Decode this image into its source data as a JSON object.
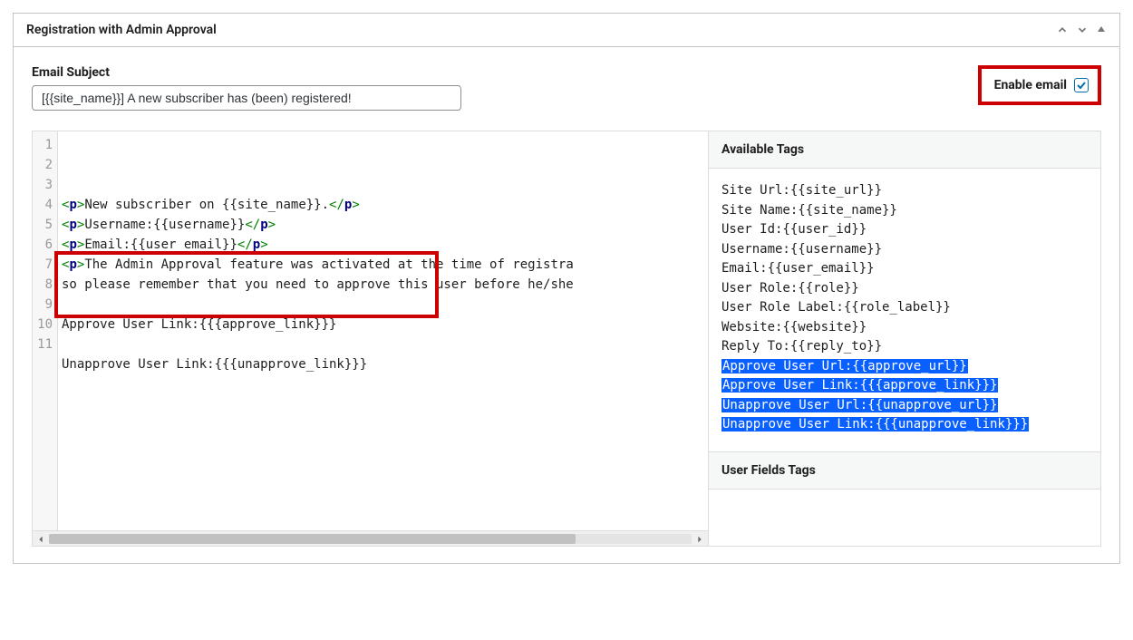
{
  "panel": {
    "title": "Registration with Admin Approval"
  },
  "subject": {
    "label": "Email Subject",
    "value": "[{{site_name}}] A new subscriber has (been) registered!"
  },
  "enable": {
    "label": "Enable email",
    "checked": true
  },
  "code": {
    "lines": [
      [
        {
          "t": "<p>",
          "c": "tag"
        },
        {
          "t": "New subscriber on {{site_name}}.",
          "c": ""
        },
        {
          "t": "</p>",
          "c": "tag"
        }
      ],
      [
        {
          "t": "<p>",
          "c": "tag"
        },
        {
          "t": "Username:{{username}}",
          "c": ""
        },
        {
          "t": "</p>",
          "c": "tag"
        }
      ],
      [
        {
          "t": "<p>",
          "c": "tag"
        },
        {
          "t": "Email:{{user_email}}",
          "c": ""
        },
        {
          "t": "</p>",
          "c": "tag"
        }
      ],
      [
        {
          "t": "<p>",
          "c": "tag"
        },
        {
          "t": "The Admin Approval feature was activated at the time of registra",
          "c": ""
        }
      ],
      [
        {
          "t": "so please remember that you need to approve this user before he/she",
          "c": ""
        }
      ],
      [],
      [
        {
          "t": "Approve User Link:{{{approve_link}}}",
          "c": ""
        }
      ],
      [],
      [
        {
          "t": "Unapprove User Link:{{{unapprove_link}}}",
          "c": ""
        }
      ],
      [],
      []
    ]
  },
  "tags": {
    "available_title": "Available Tags",
    "user_fields_title": "User Fields Tags",
    "items": [
      {
        "text": "Site Url:{{site_url}}",
        "hl": false
      },
      {
        "text": "Site Name:{{site_name}}",
        "hl": false
      },
      {
        "text": "User Id:{{user_id}}",
        "hl": false
      },
      {
        "text": "Username:{{username}}",
        "hl": false
      },
      {
        "text": "Email:{{user_email}}",
        "hl": false
      },
      {
        "text": "User Role:{{role}}",
        "hl": false
      },
      {
        "text": "User Role Label:{{role_label}}",
        "hl": false
      },
      {
        "text": "Website:{{website}}",
        "hl": false
      },
      {
        "text": "Reply To:{{reply_to}}",
        "hl": false
      },
      {
        "text": "Approve User Url:{{approve_url}}",
        "hl": true
      },
      {
        "text": "Approve User Link:{{{approve_link}}}",
        "hl": true
      },
      {
        "text": "Unapprove User Url:{{unapprove_url}}",
        "hl": true
      },
      {
        "text": "Unapprove User Link:{{{unapprove_link}}}",
        "hl": true
      }
    ]
  }
}
